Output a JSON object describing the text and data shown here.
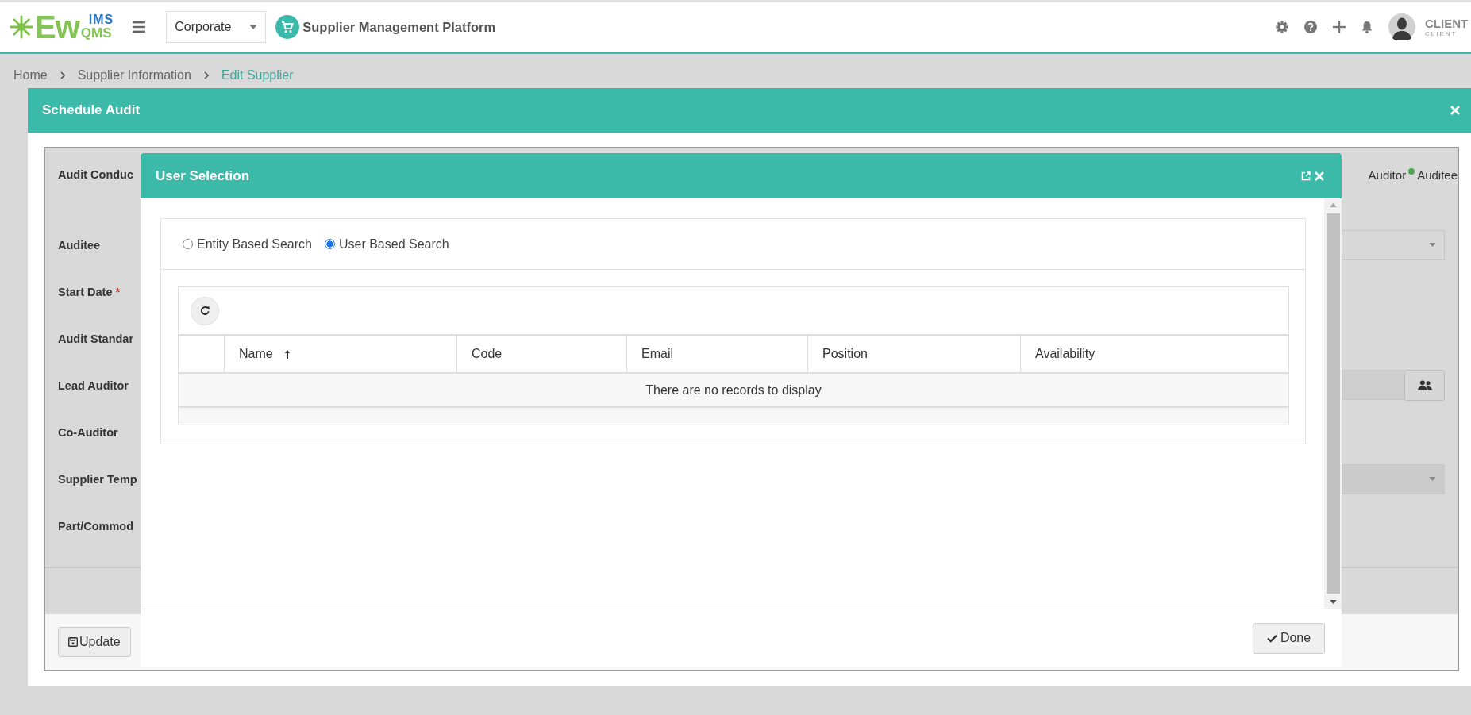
{
  "header": {
    "logo": {
      "main": "Ew",
      "superscript": "IMS",
      "subscript": "QMS"
    },
    "entity_select": {
      "value": "Corporate"
    },
    "app_title": "Supplier Management Platform",
    "user": {
      "name": "CLIENT",
      "role": "CLIENT"
    }
  },
  "breadcrumb": [
    {
      "label": "Home",
      "current": false
    },
    {
      "label": "Supplier Information",
      "current": false
    },
    {
      "label": "Edit Supplier",
      "current": true
    }
  ],
  "schedule_audit": {
    "title": "Schedule Audit",
    "fields": [
      {
        "label": "Audit Conduc",
        "kind": "legend",
        "legend": [
          {
            "label": "Auditor"
          },
          {
            "label": "Auditee",
            "color": "#4fa84f"
          }
        ]
      },
      {
        "label": "Auditee",
        "kind": "select"
      },
      {
        "label": "Start Date",
        "required_mark": "*",
        "kind": "empty"
      },
      {
        "label": "Audit Standar",
        "kind": "empty"
      },
      {
        "label": "Lead Auditor",
        "kind": "picker"
      },
      {
        "label": "Co-Auditor",
        "kind": "empty"
      },
      {
        "label": "Supplier Temp",
        "kind": "readonly"
      },
      {
        "label": "Part/Commod",
        "kind": "empty"
      }
    ],
    "update_button": "Update"
  },
  "user_selection": {
    "title": "User Selection",
    "search_modes": [
      {
        "label": "Entity Based Search",
        "selected": false
      },
      {
        "label": "User Based Search",
        "selected": true
      }
    ],
    "table": {
      "columns": [
        {
          "label": "Name",
          "sorted": true
        },
        {
          "label": "Code",
          "sorted": false
        },
        {
          "label": "Email",
          "sorted": false
        },
        {
          "label": "Position",
          "sorted": false
        },
        {
          "label": "Availability",
          "sorted": false
        }
      ],
      "empty_message": "There are no records to display"
    },
    "done_button": "Done"
  }
}
